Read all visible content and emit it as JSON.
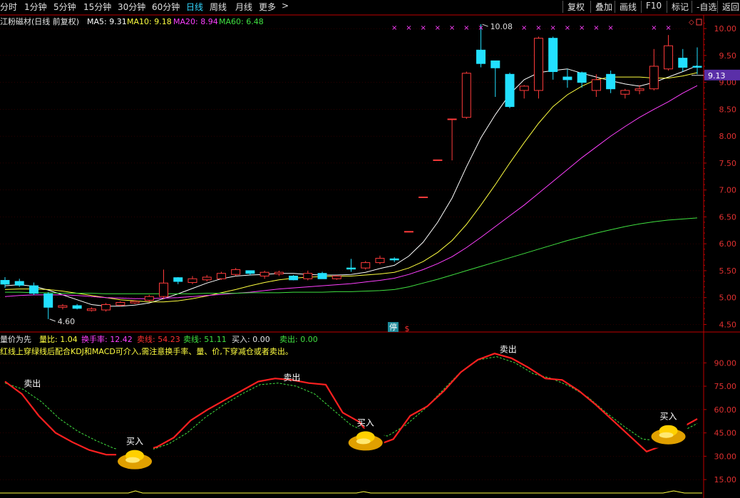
{
  "toolbar": {
    "tabs": [
      {
        "label": "分时",
        "active": false
      },
      {
        "label": "1分钟",
        "active": false
      },
      {
        "label": "5分钟",
        "active": false
      },
      {
        "label": "15分钟",
        "active": false
      },
      {
        "label": "30分钟",
        "active": false
      },
      {
        "label": "60分钟",
        "active": false
      },
      {
        "label": "日线",
        "active": true
      },
      {
        "label": "周线",
        "active": false
      },
      {
        "label": "月线",
        "active": false
      },
      {
        "label": "更多",
        "active": false
      }
    ],
    "more_arrow": ">",
    "right_buttons": [
      "复权",
      "叠加",
      "画线",
      "F10",
      "标记",
      "-自选",
      "返回"
    ]
  },
  "main_header": {
    "title": "江粉磁材(日线 前复权)",
    "ma5": "MA5: 9.31",
    "ma10": "MA10: 9.18",
    "ma20": "MA20: 8.94",
    "ma60": "MA60: 6.48"
  },
  "sub_header": {
    "title": "量价为先",
    "vr": "量比: 1.04",
    "turnover": "换手率: 12.42",
    "sell_line": "卖线: 54.23",
    "buy_line": "卖线: 51.11",
    "buy": "买入: 0.00",
    "sell": "卖出: 0.00",
    "note": "红线上穿绿线后配合KDJ和MACD可介入,需注意换手率、量、价,下穿减仓或者卖出。"
  },
  "badges": {
    "stop": "停",
    "s": "$",
    "high": "10.08",
    "low": "4.60",
    "price": "9.13"
  },
  "colors": {
    "up": "#ff3b3b",
    "down": "#22e0ff",
    "ma5": "#ffffff",
    "ma10": "#ffff40",
    "ma20": "#ff40ff",
    "ma60": "#40e040",
    "axis": "#c00000",
    "grid": "#5a0000"
  },
  "chart_data": [
    {
      "type": "candlestick",
      "ylim": [
        4.4,
        10.2
      ],
      "y_ticks": [
        4.5,
        5.0,
        5.5,
        6.0,
        6.5,
        7.0,
        7.5,
        8.0,
        8.5,
        9.0,
        9.5,
        10.0
      ],
      "current_price": 9.13,
      "candles": [
        {
          "o": 5.32,
          "h": 5.38,
          "l": 5.18,
          "c": 5.25
        },
        {
          "o": 5.3,
          "h": 5.35,
          "l": 5.2,
          "c": 5.23
        },
        {
          "o": 5.22,
          "h": 5.28,
          "l": 5.05,
          "c": 5.08
        },
        {
          "o": 5.07,
          "h": 5.1,
          "l": 4.6,
          "c": 4.82
        },
        {
          "o": 4.82,
          "h": 4.88,
          "l": 4.78,
          "c": 4.85
        },
        {
          "o": 4.85,
          "h": 4.88,
          "l": 4.78,
          "c": 4.8
        },
        {
          "o": 4.76,
          "h": 4.82,
          "l": 4.74,
          "c": 4.79
        },
        {
          "o": 4.77,
          "h": 4.9,
          "l": 4.74,
          "c": 4.87
        },
        {
          "o": 4.86,
          "h": 4.93,
          "l": 4.84,
          "c": 4.91
        },
        {
          "o": 4.9,
          "h": 4.95,
          "l": 4.88,
          "c": 4.93
        },
        {
          "o": 4.95,
          "h": 5.05,
          "l": 4.92,
          "c": 5.02
        },
        {
          "o": 5.02,
          "h": 5.52,
          "l": 4.98,
          "c": 5.27
        },
        {
          "o": 5.37,
          "h": 5.38,
          "l": 5.25,
          "c": 5.3
        },
        {
          "o": 5.28,
          "h": 5.4,
          "l": 5.25,
          "c": 5.35
        },
        {
          "o": 5.33,
          "h": 5.42,
          "l": 5.3,
          "c": 5.38
        },
        {
          "o": 5.35,
          "h": 5.48,
          "l": 5.33,
          "c": 5.45
        },
        {
          "o": 5.43,
          "h": 5.55,
          "l": 5.4,
          "c": 5.52
        },
        {
          "o": 5.5,
          "h": 5.5,
          "l": 5.42,
          "c": 5.45
        },
        {
          "o": 5.4,
          "h": 5.5,
          "l": 5.35,
          "c": 5.47
        },
        {
          "o": 5.44,
          "h": 5.5,
          "l": 5.4,
          "c": 5.47
        },
        {
          "o": 5.4,
          "h": 5.42,
          "l": 5.32,
          "c": 5.33
        },
        {
          "o": 5.35,
          "h": 5.5,
          "l": 5.32,
          "c": 5.45
        },
        {
          "o": 5.45,
          "h": 5.48,
          "l": 5.35,
          "c": 5.35
        },
        {
          "o": 5.35,
          "h": 5.42,
          "l": 5.33,
          "c": 5.4
        },
        {
          "o": 5.55,
          "h": 5.72,
          "l": 5.48,
          "c": 5.53
        },
        {
          "o": 5.55,
          "h": 5.68,
          "l": 5.52,
          "c": 5.65
        },
        {
          "o": 5.65,
          "h": 5.78,
          "l": 5.62,
          "c": 5.73
        },
        {
          "o": 5.72,
          "h": 5.75,
          "l": 5.66,
          "c": 5.7
        },
        {
          "o": 6.23,
          "h": 6.23,
          "l": 6.23,
          "c": 6.23
        },
        {
          "o": 6.87,
          "h": 6.87,
          "l": 6.87,
          "c": 6.87
        },
        {
          "o": 7.56,
          "h": 7.56,
          "l": 7.56,
          "c": 7.56
        },
        {
          "o": 8.32,
          "h": 8.32,
          "l": 7.55,
          "c": 8.32
        },
        {
          "o": 8.35,
          "h": 9.2,
          "l": 8.32,
          "c": 9.17
        },
        {
          "o": 9.6,
          "h": 10.08,
          "l": 9.28,
          "c": 9.35
        },
        {
          "o": 9.4,
          "h": 9.4,
          "l": 8.73,
          "c": 9.27
        },
        {
          "o": 9.15,
          "h": 9.18,
          "l": 8.52,
          "c": 8.55
        },
        {
          "o": 8.85,
          "h": 8.95,
          "l": 8.7,
          "c": 8.93
        },
        {
          "o": 8.85,
          "h": 9.85,
          "l": 8.7,
          "c": 9.82
        },
        {
          "o": 9.82,
          "h": 9.85,
          "l": 9.05,
          "c": 9.2
        },
        {
          "o": 9.1,
          "h": 9.25,
          "l": 8.9,
          "c": 9.05
        },
        {
          "o": 9.18,
          "h": 9.2,
          "l": 8.9,
          "c": 9.0
        },
        {
          "o": 8.85,
          "h": 9.15,
          "l": 8.73,
          "c": 9.05
        },
        {
          "o": 9.15,
          "h": 9.22,
          "l": 8.8,
          "c": 8.88
        },
        {
          "o": 8.78,
          "h": 8.88,
          "l": 8.7,
          "c": 8.85
        },
        {
          "o": 8.85,
          "h": 8.95,
          "l": 8.78,
          "c": 8.88
        },
        {
          "o": 8.88,
          "h": 9.62,
          "l": 8.85,
          "c": 9.3
        },
        {
          "o": 9.25,
          "h": 9.88,
          "l": 9.22,
          "c": 9.68
        },
        {
          "o": 9.45,
          "h": 9.62,
          "l": 9.2,
          "c": 9.28
        },
        {
          "o": 9.3,
          "h": 9.65,
          "l": 9.15,
          "c": 9.28
        }
      ],
      "series": [
        {
          "name": "MA5",
          "values": [
            5.22,
            5.24,
            5.21,
            5.14,
            5.05,
            4.96,
            4.87,
            4.84,
            4.84,
            4.86,
            4.9,
            4.98,
            5.07,
            5.17,
            5.27,
            5.35,
            5.4,
            5.42,
            5.43,
            5.45,
            5.45,
            5.43,
            5.42,
            5.42,
            5.43,
            5.47,
            5.54,
            5.6,
            5.77,
            6.03,
            6.4,
            6.85,
            7.43,
            7.97,
            8.4,
            8.78,
            9.05,
            9.18,
            9.22,
            9.25,
            9.17,
            9.1,
            9.03,
            8.97,
            8.93,
            9.0,
            9.1,
            9.2,
            9.31
          ]
        },
        {
          "name": "MA10",
          "values": [
            5.15,
            5.16,
            5.16,
            5.15,
            5.12,
            5.08,
            5.04,
            5.0,
            4.96,
            4.94,
            4.92,
            4.92,
            4.94,
            4.98,
            5.03,
            5.09,
            5.15,
            5.22,
            5.28,
            5.33,
            5.36,
            5.38,
            5.39,
            5.4,
            5.4,
            5.42,
            5.44,
            5.47,
            5.55,
            5.67,
            5.84,
            6.06,
            6.36,
            6.72,
            7.1,
            7.5,
            7.88,
            8.24,
            8.55,
            8.77,
            8.93,
            9.05,
            9.1,
            9.1,
            9.1,
            9.08,
            9.08,
            9.12,
            9.18
          ]
        },
        {
          "name": "MA20",
          "values": [
            5.02,
            5.04,
            5.05,
            5.05,
            5.05,
            5.04,
            5.02,
            5.0,
            4.99,
            4.98,
            4.98,
            4.99,
            5.0,
            5.02,
            5.04,
            5.06,
            5.08,
            5.1,
            5.13,
            5.16,
            5.18,
            5.2,
            5.22,
            5.24,
            5.26,
            5.29,
            5.32,
            5.36,
            5.43,
            5.52,
            5.63,
            5.76,
            5.93,
            6.12,
            6.32,
            6.52,
            6.72,
            6.94,
            7.16,
            7.38,
            7.6,
            7.8,
            8.0,
            8.18,
            8.35,
            8.5,
            8.64,
            8.8,
            8.94
          ]
        },
        {
          "name": "MA60",
          "values": [
            5.1,
            5.1,
            5.09,
            5.09,
            5.08,
            5.08,
            5.08,
            5.07,
            5.07,
            5.07,
            5.07,
            5.07,
            5.07,
            5.07,
            5.08,
            5.08,
            5.08,
            5.09,
            5.09,
            5.09,
            5.1,
            5.1,
            5.1,
            5.11,
            5.11,
            5.12,
            5.13,
            5.15,
            5.2,
            5.27,
            5.34,
            5.42,
            5.5,
            5.58,
            5.66,
            5.74,
            5.82,
            5.9,
            5.98,
            6.06,
            6.13,
            6.2,
            6.26,
            6.32,
            6.37,
            6.41,
            6.44,
            6.46,
            6.48
          ]
        }
      ],
      "annotations": [
        {
          "label": "10.08",
          "index": 33,
          "value": 10.08
        },
        {
          "label": "4.60",
          "index": 3,
          "value": 4.6
        }
      ]
    },
    {
      "type": "line",
      "ylim": [
        5,
        108
      ],
      "y_ticks": [
        15.0,
        30.0,
        45.0,
        60.0,
        75.0,
        90.0
      ],
      "series": [
        {
          "name": "卖线",
          "values": [
            78,
            70,
            56,
            45,
            39,
            34,
            31,
            31,
            33,
            36,
            42,
            53,
            60,
            66,
            72,
            78,
            80,
            79,
            77,
            76,
            58,
            52,
            37,
            41,
            56,
            62,
            72,
            84,
            92,
            96,
            93,
            87,
            80,
            79,
            72,
            63,
            53,
            43,
            33,
            37,
            48,
            54
          ]
        },
        {
          "name": "买线",
          "values": [
            77,
            73,
            65,
            54,
            46,
            40,
            35,
            33,
            34,
            38,
            45,
            55,
            63,
            70,
            76,
            77,
            75,
            70,
            60,
            50,
            45,
            43,
            50,
            60,
            72,
            84,
            92,
            94,
            90,
            83,
            80,
            75,
            68,
            58,
            49,
            41,
            40,
            45,
            51
          ]
        }
      ],
      "markers": [
        {
          "label": "卖出",
          "index": 1,
          "value": 72
        },
        {
          "label": "买入",
          "index": 9,
          "value": 34
        },
        {
          "label": "卖出",
          "index": 19,
          "value": 76
        },
        {
          "label": "买入",
          "index": 25,
          "value": 46
        },
        {
          "label": "卖出",
          "index": 34,
          "value": 94
        },
        {
          "label": "买入",
          "index": 46,
          "value": 50
        }
      ]
    }
  ]
}
